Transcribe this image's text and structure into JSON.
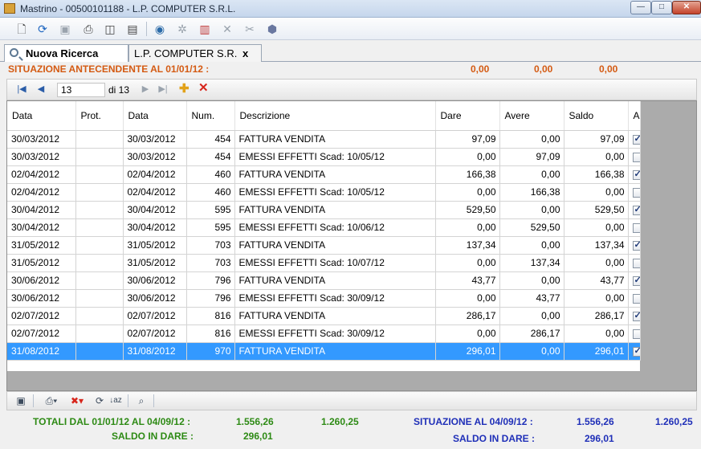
{
  "window": {
    "title": "Mastrino - 00500101188 - L.P. COMPUTER S.R.L."
  },
  "toolbar": {
    "icons": [
      "new-doc-icon",
      "refresh-icon",
      "save-icon",
      "print-icon",
      "print-preview-icon",
      "report-icon",
      "find-icon",
      "settings-icon",
      "columns-icon",
      "delete-icon",
      "tools-icon",
      "export-icon"
    ]
  },
  "tabs": {
    "search_label": "Nuova Ricerca",
    "client_label": "L.P. COMPUTER S.R.",
    "client_close": "x"
  },
  "prior": {
    "label": "SITUAZIONE ANTECENDENTE AL 01/01/12 :",
    "dare": "0,00",
    "avere": "0,00",
    "saldo": "0,00"
  },
  "navigator": {
    "position": "13",
    "of_label": "di 13"
  },
  "grid": {
    "columns": [
      "Data",
      "Prot.",
      "Data",
      "Num.",
      "Descrizione",
      "Dare",
      "Avere",
      "Saldo",
      "A"
    ],
    "rows": [
      {
        "data": "30/03/2012",
        "prot": "",
        "data_doc": "30/03/2012",
        "num": "454",
        "descr": "FATTURA VENDITA",
        "dare": "97,09",
        "avere": "0,00",
        "saldo": "97,09",
        "a": true
      },
      {
        "data": "30/03/2012",
        "prot": "",
        "data_doc": "30/03/2012",
        "num": "454",
        "descr": "EMESSI EFFETTI Scad: 10/05/12",
        "dare": "0,00",
        "avere": "97,09",
        "saldo": "0,00",
        "a": false
      },
      {
        "data": "02/04/2012",
        "prot": "",
        "data_doc": "02/04/2012",
        "num": "460",
        "descr": "FATTURA VENDITA",
        "dare": "166,38",
        "avere": "0,00",
        "saldo": "166,38",
        "a": true
      },
      {
        "data": "02/04/2012",
        "prot": "",
        "data_doc": "02/04/2012",
        "num": "460",
        "descr": "EMESSI EFFETTI Scad: 10/05/12",
        "dare": "0,00",
        "avere": "166,38",
        "saldo": "0,00",
        "a": false
      },
      {
        "data": "30/04/2012",
        "prot": "",
        "data_doc": "30/04/2012",
        "num": "595",
        "descr": "FATTURA VENDITA",
        "dare": "529,50",
        "avere": "0,00",
        "saldo": "529,50",
        "a": true
      },
      {
        "data": "30/04/2012",
        "prot": "",
        "data_doc": "30/04/2012",
        "num": "595",
        "descr": "EMESSI EFFETTI Scad: 10/06/12",
        "dare": "0,00",
        "avere": "529,50",
        "saldo": "0,00",
        "a": false
      },
      {
        "data": "31/05/2012",
        "prot": "",
        "data_doc": "31/05/2012",
        "num": "703",
        "descr": "FATTURA VENDITA",
        "dare": "137,34",
        "avere": "0,00",
        "saldo": "137,34",
        "a": true
      },
      {
        "data": "31/05/2012",
        "prot": "",
        "data_doc": "31/05/2012",
        "num": "703",
        "descr": "EMESSI EFFETTI Scad: 10/07/12",
        "dare": "0,00",
        "avere": "137,34",
        "saldo": "0,00",
        "a": false
      },
      {
        "data": "30/06/2012",
        "prot": "",
        "data_doc": "30/06/2012",
        "num": "796",
        "descr": "FATTURA VENDITA",
        "dare": "43,77",
        "avere": "0,00",
        "saldo": "43,77",
        "a": true
      },
      {
        "data": "30/06/2012",
        "prot": "",
        "data_doc": "30/06/2012",
        "num": "796",
        "descr": "EMESSI EFFETTI Scad: 30/09/12",
        "dare": "0,00",
        "avere": "43,77",
        "saldo": "0,00",
        "a": false
      },
      {
        "data": "02/07/2012",
        "prot": "",
        "data_doc": "02/07/2012",
        "num": "816",
        "descr": "FATTURA VENDITA",
        "dare": "286,17",
        "avere": "0,00",
        "saldo": "286,17",
        "a": true
      },
      {
        "data": "02/07/2012",
        "prot": "",
        "data_doc": "02/07/2012",
        "num": "816",
        "descr": "EMESSI EFFETTI Scad: 30/09/12",
        "dare": "0,00",
        "avere": "286,17",
        "saldo": "0,00",
        "a": false
      },
      {
        "data": "31/08/2012",
        "prot": "",
        "data_doc": "31/08/2012",
        "num": "970",
        "descr": "FATTURA VENDITA",
        "dare": "296,01",
        "avere": "0,00",
        "saldo": "296,01",
        "a": true,
        "selected": true
      }
    ]
  },
  "totals": {
    "left_label": "TOTALI DAL 01/01/12 AL 04/09/12 :",
    "left_dare": "1.556,26",
    "left_avere": "1.260,25",
    "left_saldo_label": "SALDO IN DARE :",
    "left_saldo": "296,01",
    "right_label": "SITUAZIONE AL 04/09/12 :",
    "right_dare": "1.556,26",
    "right_avere": "1.260,25",
    "right_saldo_label": "SALDO IN DARE :",
    "right_saldo": "296,01"
  },
  "colors": {
    "accent_orange": "#d45a12",
    "total_green": "#2d8a14",
    "total_blue": "#1f2fb8",
    "selection": "#3399ff"
  }
}
